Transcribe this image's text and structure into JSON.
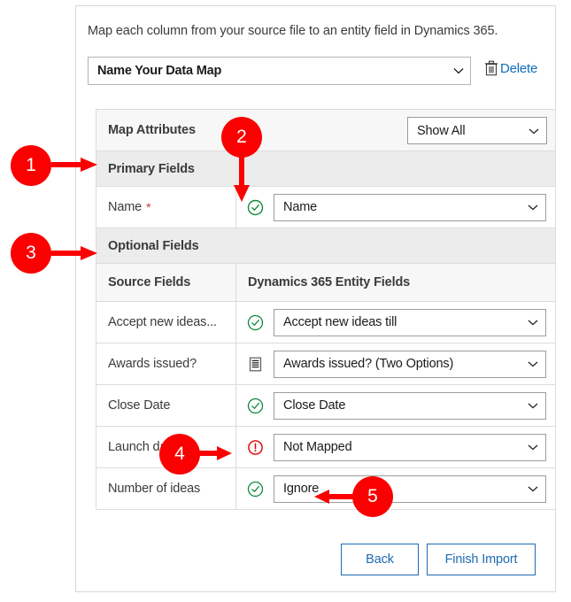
{
  "dialog": {
    "intro_text": "Map each column from your source file to an entity field in Dynamics 365.",
    "datamap": {
      "value": "Name Your Data Map",
      "chevron_icon": "chevron-down-icon"
    },
    "delete": {
      "label": "Delete",
      "icon": "trash-icon",
      "color": "#0f6cbd"
    },
    "table": {
      "attributes_header": {
        "title": "Map Attributes",
        "filter_value": "Show All"
      },
      "sections": {
        "primary": "Primary Fields",
        "optional": "Optional Fields"
      },
      "column_headers": {
        "source": "Source Fields",
        "target": "Dynamics 365 Entity Fields"
      },
      "primary_rows": [
        {
          "source": "Name",
          "required": true,
          "required_marker": "*",
          "status_icon": "check-circle-icon",
          "status": "mapped",
          "target": "Name"
        }
      ],
      "optional_rows": [
        {
          "source": "Accept new ideas...",
          "required": false,
          "status_icon": "check-circle-icon",
          "status": "mapped",
          "target": "Accept new ideas till"
        },
        {
          "source": "Awards issued?",
          "required": false,
          "status_icon": "list-options-icon",
          "status": "option-set",
          "target": "Awards issued? (Two Options)"
        },
        {
          "source": "Close Date",
          "required": false,
          "status_icon": "check-circle-icon",
          "status": "mapped",
          "target": "Close Date"
        },
        {
          "source": "Launch date",
          "required": false,
          "status_icon": "warning-circle-icon",
          "status": "not-mapped",
          "target": "Not Mapped"
        },
        {
          "source": "Number of ideas",
          "required": false,
          "status_icon": "check-circle-icon",
          "status": "mapped",
          "target": "Ignore"
        }
      ]
    },
    "footer": {
      "back_label": "Back",
      "finish_label": "Finish Import"
    }
  },
  "callouts": [
    {
      "number": "1",
      "points_to": "Primary Fields section header"
    },
    {
      "number": "2",
      "points_to": "Name row status check icon"
    },
    {
      "number": "3",
      "points_to": "Optional Fields section header"
    },
    {
      "number": "4",
      "points_to": "Launch date not-mapped warning icon"
    },
    {
      "number": "5",
      "points_to": "Ignore target value"
    }
  ],
  "colors": {
    "callout_red": "#fa0000",
    "status_green": "#10893e",
    "status_red": "#d13438",
    "link_blue": "#0f6cbd",
    "button_blue": "#1f6bb0"
  }
}
